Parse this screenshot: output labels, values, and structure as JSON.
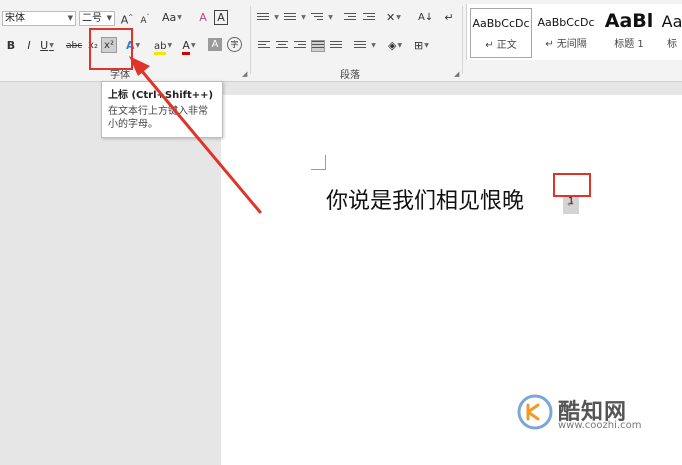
{
  "font_group": {
    "font_name": "宋体",
    "font_size": "二号",
    "grow_font": "A",
    "shrink_font": "A",
    "change_case": "Aa",
    "clear_format": "A",
    "char_border": "A",
    "bold": "B",
    "italic": "I",
    "underline": "U",
    "strikethrough": "abc",
    "subscript": "x₂",
    "superscript": "x²",
    "text_effects": "A",
    "highlight": "ab",
    "font_color": "A",
    "char_shading": "A",
    "enclose_char": "字",
    "label": "字体"
  },
  "paragraph_group": {
    "sort": "A↓",
    "label": "段落"
  },
  "styles": [
    {
      "preview": "AaBbCcDc",
      "name": "↵ 正文"
    },
    {
      "preview": "AaBbCcDc",
      "name": "↵ 无间隔"
    },
    {
      "preview": "AaBl",
      "name": "标题 1"
    },
    {
      "preview": "Aa",
      "name": "标"
    }
  ],
  "tooltip": {
    "title": "上标 (Ctrl+Shift++)",
    "description": "在文本行上方键入非常小的字母。"
  },
  "document": {
    "text": "你说是我们相见恨晚",
    "superscript_value": "1",
    "paragraph_mark": "↵"
  },
  "watermark": {
    "brand": "酷知网",
    "url": "www.coozhi.com"
  },
  "colors": {
    "annotation_red": "#e0342b",
    "highlight_yellow": "#f5e600",
    "font_color_red": "#d40000"
  }
}
